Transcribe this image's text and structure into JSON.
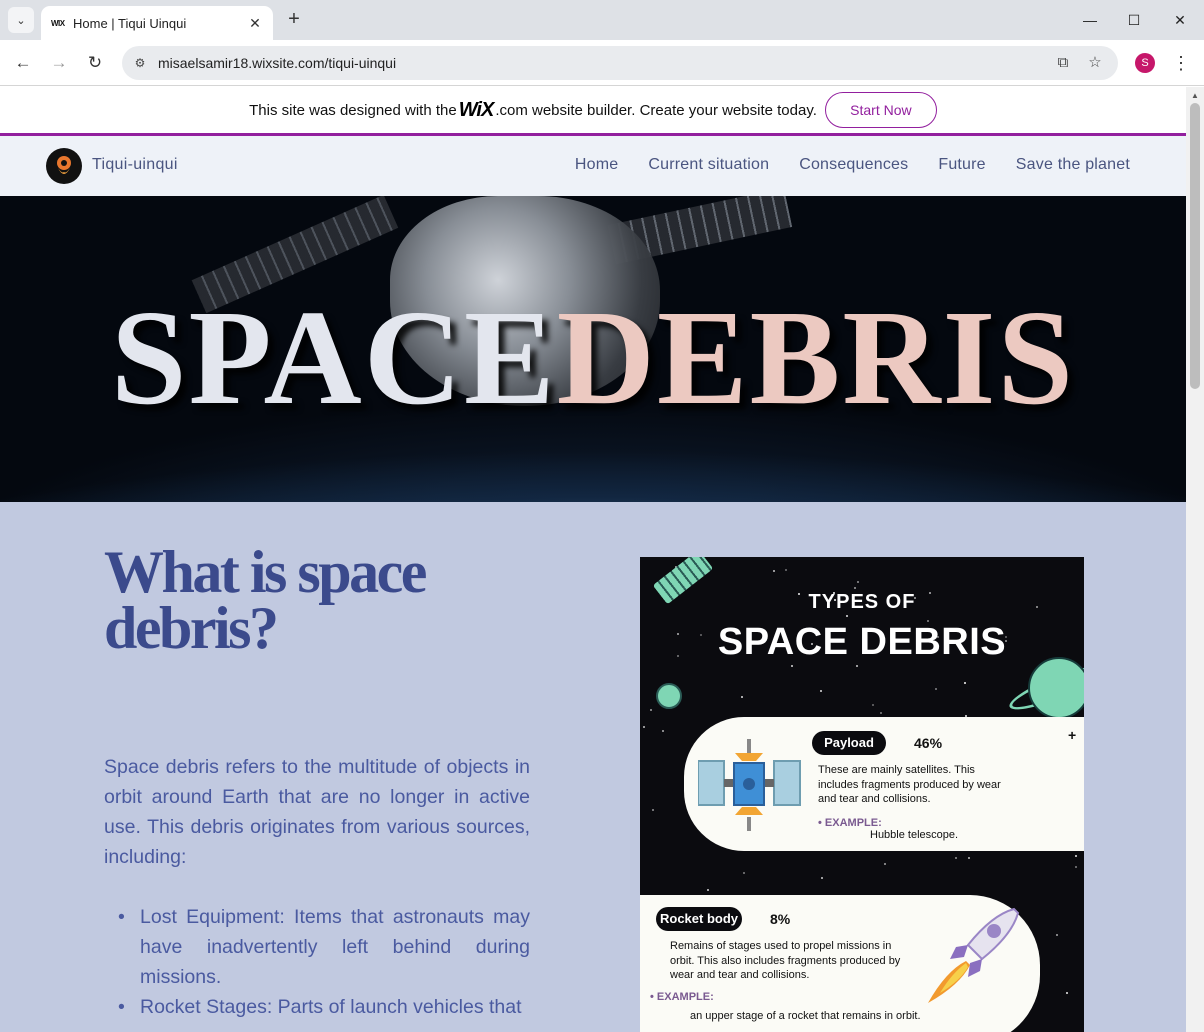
{
  "browser": {
    "tab_title": "Home | Tiqui Uinqui",
    "tab_favicon": "WIX",
    "url": "misaelsamir18.wixsite.com/tiqui-uinqui",
    "profile_initial": "S"
  },
  "wix_banner": {
    "text_before": "This site was designed with the",
    "logo": "WiX",
    "text_after": ".com website builder. Create your website today.",
    "button_label": "Start Now"
  },
  "site_header": {
    "site_name": "Tiqui-uinqui",
    "nav": [
      "Home",
      "Current situation",
      "Consequences",
      "Future",
      "Save the planet"
    ]
  },
  "hero": {
    "title_part1": "SPACE",
    "title_part2": "DEBRIS"
  },
  "content": {
    "title": "What is space debris?",
    "intro": "Space debris refers to the multitude of objects in orbit around Earth that are no longer in active use. This debris originates from various sources, including:",
    "bullets": [
      "Lost Equipment: Items that astronauts may have inadvertently left behind during missions.",
      "Rocket Stages: Parts of launch vehicles that"
    ]
  },
  "infographic": {
    "title_small": "TYPES OF",
    "title_big": "SPACE DEBRIS",
    "cards": [
      {
        "label": "Payload",
        "percent": "46%",
        "description": "These are mainly satellites. This includes fragments produced by wear and tear and collisions.",
        "example_label": "EXAMPLE:",
        "example": "Hubble telescope."
      },
      {
        "label": "Rocket body",
        "percent": "8%",
        "description": "Remains of stages used to propel missions in orbit. This also includes fragments produced by wear and tear and collisions.",
        "example_label": "EXAMPLE:",
        "example": "an upper stage of a rocket that remains in orbit."
      }
    ]
  },
  "colors": {
    "wix_accent": "#921f9e",
    "page_bg": "#c1c9e0",
    "heading": "#3b4a8c",
    "body_text": "#4a5aa0",
    "profile": "#c6176a"
  }
}
